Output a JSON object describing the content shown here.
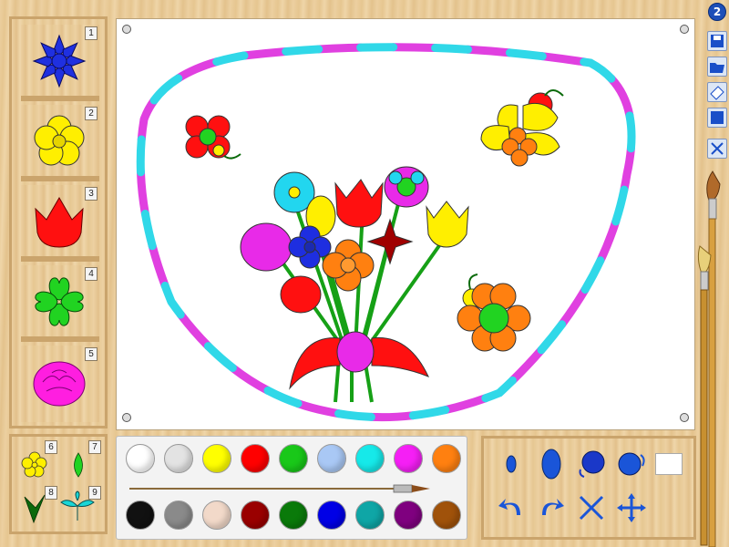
{
  "app": {
    "help_label": "2"
  },
  "shapes_panel": {
    "items": [
      {
        "num": "1",
        "icon": "cornflower-icon",
        "color": "#1f30e0"
      },
      {
        "num": "2",
        "icon": "primrose-icon",
        "color": "#ffef00"
      },
      {
        "num": "3",
        "icon": "tulip-icon",
        "color": "#ff1010"
      },
      {
        "num": "4",
        "icon": "clover-icon",
        "color": "#21d321"
      },
      {
        "num": "5",
        "icon": "rose-icon",
        "color": "#ff1ee0"
      }
    ],
    "small_items": [
      {
        "num": "6",
        "icon": "small-flower-icon"
      },
      {
        "num": "7",
        "icon": "bud-icon"
      },
      {
        "num": "8",
        "icon": "leaf-stem-icon"
      },
      {
        "num": "9",
        "icon": "leaf-sprig-icon"
      }
    ]
  },
  "colors": {
    "row1": [
      "#ffffff",
      "#e3e3e3",
      "#ffff00",
      "#ff0000",
      "#19c819",
      "#a9c8f5",
      "#16e9e9",
      "#f51ff5",
      "#ff8010"
    ],
    "row2": [
      "#111111",
      "#8a8a8a",
      "#f2d9c9",
      "#9a0000",
      "#0a7a0a",
      "#0000e6",
      "#0fa6a6",
      "#7f007f",
      "#a0520a"
    ]
  },
  "tools": [
    {
      "name": "small-drop-tool",
      "icon": "small-drop-icon"
    },
    {
      "name": "large-drop-tool",
      "icon": "large-drop-icon"
    },
    {
      "name": "rotate-left-tool",
      "icon": "rotate-left-icon"
    },
    {
      "name": "rotate-right-tool",
      "icon": "rotate-right-icon"
    },
    {
      "name": "undo-tool",
      "icon": "undo-icon"
    },
    {
      "name": "redo-tool",
      "icon": "redo-icon"
    },
    {
      "name": "clear-tool",
      "icon": "cross-icon"
    },
    {
      "name": "move-tool",
      "icon": "move-arrows-icon"
    }
  ],
  "toolbar": [
    {
      "name": "save-button",
      "icon": "floppy-disk-icon"
    },
    {
      "name": "open-button",
      "icon": "folder-icon"
    },
    {
      "name": "eraser-button",
      "icon": "eraser-icon"
    },
    {
      "name": "fill-button",
      "icon": "blue-square-icon"
    },
    {
      "name": "close-button",
      "icon": "close-icon"
    }
  ]
}
